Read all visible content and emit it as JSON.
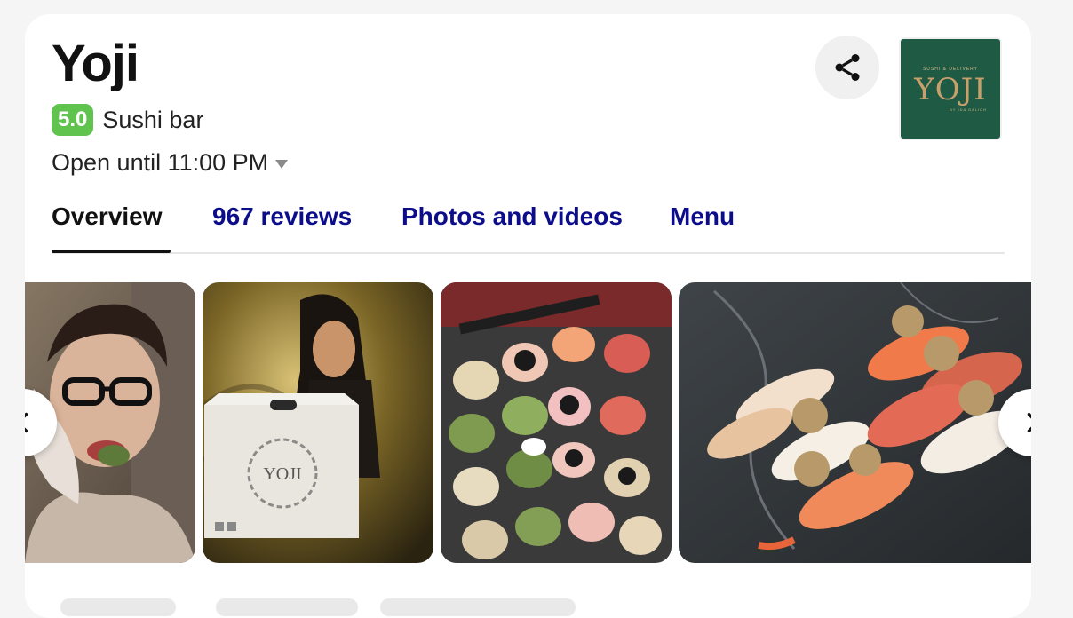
{
  "place": {
    "name": "Yoji",
    "rating": "5.0",
    "category": "Sushi bar",
    "hours": "Open until 11:00 PM"
  },
  "tabs": [
    {
      "label": "Overview",
      "active": true
    },
    {
      "label": "967 reviews",
      "active": false
    },
    {
      "label": "Photos and videos",
      "active": false
    },
    {
      "label": "Menu",
      "active": false
    }
  ],
  "logo": {
    "tagline": "SUSHI & DELIVERY",
    "word": "YOJI",
    "byline": "BY IDA GALICH"
  },
  "icons": {
    "share": "share-icon",
    "prev": "chevron-left-icon",
    "next": "chevron-right-icon",
    "hours_toggle": "caret-down-icon"
  },
  "colors": {
    "rating_badge": "#5fc34e",
    "tab_link": "#0b0d8a",
    "logo_bg": "#1f5a44"
  }
}
